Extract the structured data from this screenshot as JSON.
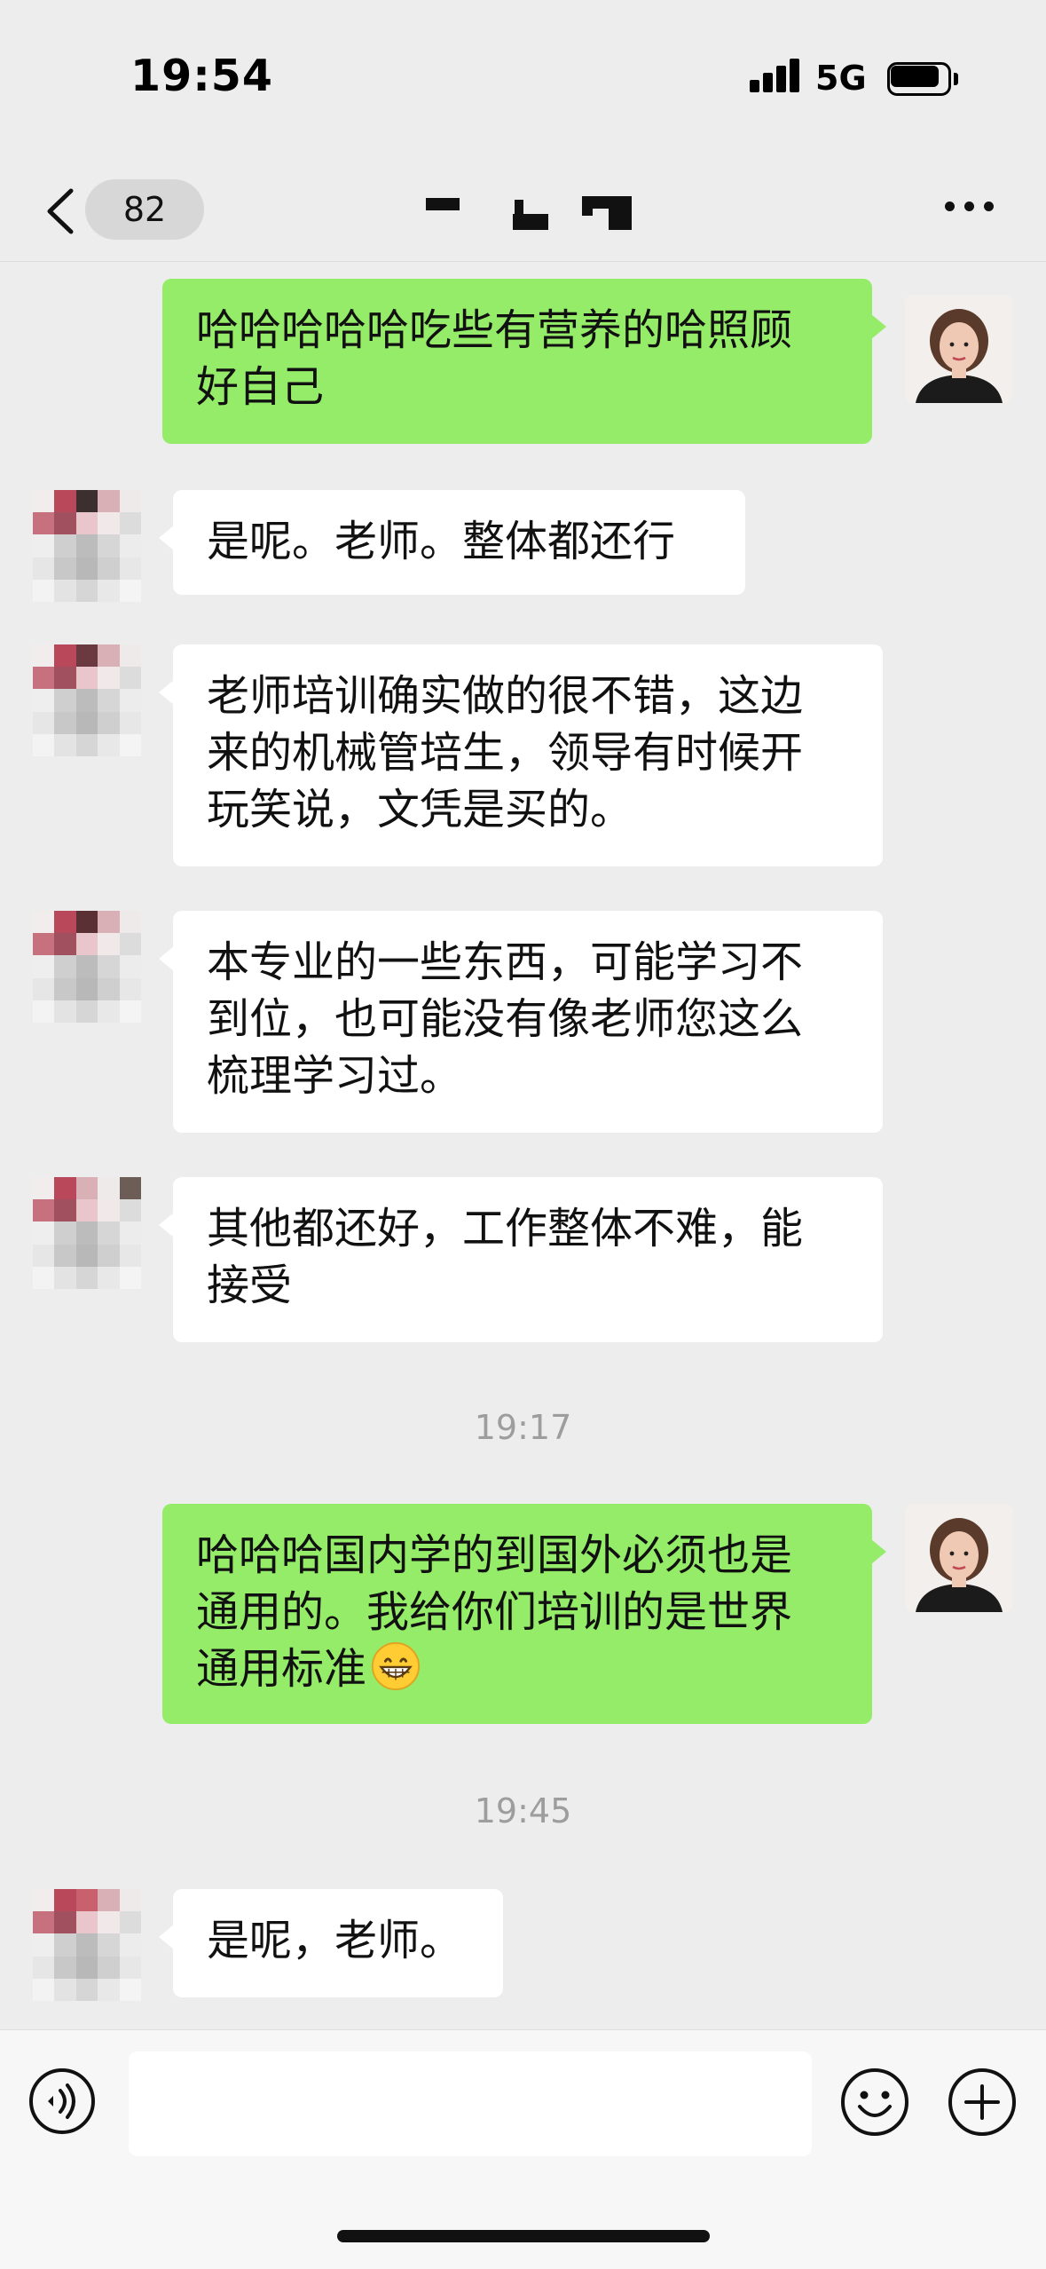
{
  "status_bar": {
    "time": "19:54",
    "network": "5G",
    "battery_level": 0.85
  },
  "nav": {
    "unread_count": "82",
    "title": "",
    "back_icon": "chevron-left-icon",
    "more_icon": "ellipsis-icon"
  },
  "messages": [
    {
      "sender": "self",
      "text": "哈哈哈哈哈吃些有营养的哈照顾\n好自己"
    },
    {
      "sender": "other",
      "text": "是呢。老师。整体都还行"
    },
    {
      "sender": "other",
      "text": "老师培训确实做的很不错，这边\n来的机械管培生，领导有时候开\n玩笑说，文凭是买的。"
    },
    {
      "sender": "other",
      "text": "本专业的一些东西，可能学习不\n到位，也可能没有像老师您这么\n梳理学习过。"
    },
    {
      "sender": "other",
      "text": "其他都还好，工作整体不难，能\n接受"
    },
    {
      "sender": "self",
      "text": "哈哈哈国内学的到国外必须也是\n通用的。我给你们培训的是世界\n通用标准",
      "emoji": "grinning-face-emoji"
    },
    {
      "sender": "other",
      "text": "是呢，老师。"
    }
  ],
  "timestamps": [
    "19:17",
    "19:45"
  ],
  "input_bar": {
    "message_value": "",
    "voice_icon": "voice-icon",
    "emoji_icon": "emoji-icon",
    "plus_icon": "plus-icon"
  },
  "colors": {
    "background": "#ededed",
    "self_bubble": "#95ec69",
    "other_bubble": "#ffffff",
    "timestamp_text": "#9d9d9d"
  }
}
